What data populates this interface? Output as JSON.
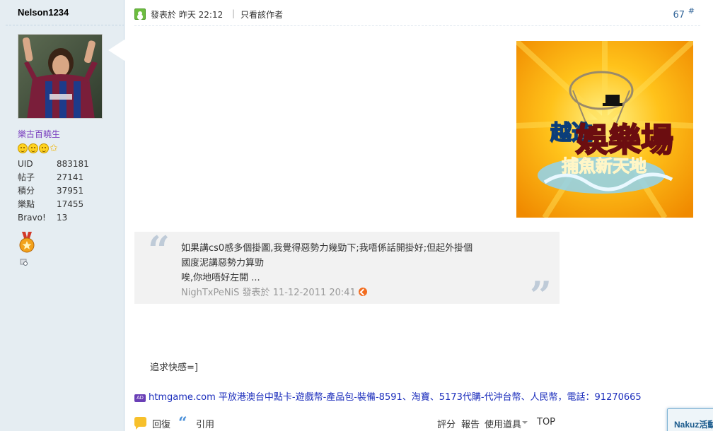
{
  "author": {
    "username": "Nelson1234",
    "rank_title": "樂古百曉生",
    "stats": [
      {
        "label": "UID",
        "value": "883181"
      },
      {
        "label": "帖子",
        "value": "27141"
      },
      {
        "label": "積分",
        "value": "37951"
      },
      {
        "label": "樂點",
        "value": "17455"
      },
      {
        "label": "Bravo!",
        "value": "13"
      }
    ]
  },
  "post": {
    "posted_at": "發表於 昨天 22:12",
    "separator": "|",
    "only_author": "只看該作者",
    "floor": "67",
    "floor_symbol": "#",
    "message": "追求快感=]"
  },
  "quote": {
    "lines": [
      "如果講cs0感多個掛圖,我覺得惡勢力幾勁下;我唔係話開掛好;但起外掛個",
      "國度泥講惡勢力算勁",
      "唉,你地唔好左開 ..."
    ],
    "meta": "NighTxPeNiS 發表於 11-12-2011 20:41"
  },
  "banner": {
    "title_line1": "越進",
    "title_main": "娛樂場",
    "subtitle": "捕魚新天地"
  },
  "ad": {
    "badge": "AD",
    "text": "htmgame.com 平放港澳台中點卡-遊戲幣-產品包-裝備-8591、淘寶、5173代購-代沖台幣、人民幣，電話：91270665"
  },
  "actions": {
    "reply": "回復",
    "quote": "引用",
    "rate": "評分",
    "report": "報告",
    "tools": "使用道具",
    "top": "TOP"
  },
  "widget": {
    "label": "Nakuz活動"
  },
  "colors": {
    "sidebar_bg": "#e5edf2",
    "rank_color": "#7a3fbf",
    "link_blue": "#1b2dbc",
    "floor_color": "#336699"
  }
}
